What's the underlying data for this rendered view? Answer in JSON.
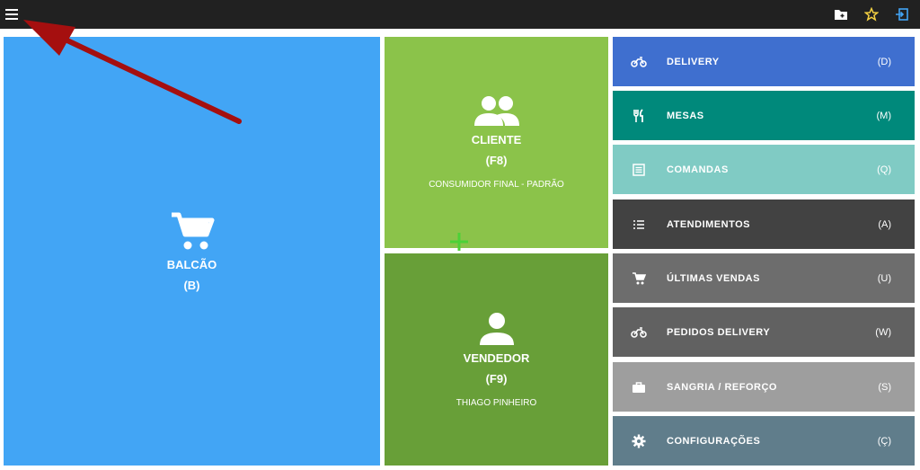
{
  "topbar": {
    "icons": [
      "menu-icon",
      "new-folder-icon",
      "star-outline-icon",
      "logout-icon"
    ],
    "accent": "#42a5f5"
  },
  "balcao": {
    "title": "BALCÃO",
    "key": "(B)",
    "color": "#42a5f5",
    "icon": "shopping-cart-icon"
  },
  "cliente": {
    "title": "CLIENTE",
    "key": "(F8)",
    "sub": "CONSUMIDOR FINAL - PADRÃO",
    "color": "#8bc34a",
    "icon": "people-icon"
  },
  "vendedor": {
    "title": "VENDEDOR",
    "key": "(F9)",
    "sub": "THIAGO PINHEIRO",
    "color": "#689f38",
    "icon": "person-icon"
  },
  "menu": [
    {
      "label": "DELIVERY",
      "key": "(D)",
      "color": "#3f6fcf",
      "icon": "motorcycle-icon"
    },
    {
      "label": "MESAS",
      "key": "(M)",
      "color": "#00897b",
      "icon": "utensils-icon"
    },
    {
      "label": "COMANDAS",
      "key": "(Q)",
      "color": "#80cbc4",
      "icon": "list-box-icon"
    },
    {
      "label": "ATENDIMENTOS",
      "key": "(A)",
      "color": "#424242",
      "icon": "list-icon"
    },
    {
      "label": "ÚLTIMAS VENDAS",
      "key": "(U)",
      "color": "#6d6d6d",
      "icon": "cart-icon"
    },
    {
      "label": "PEDIDOS DELIVERY",
      "key": "(W)",
      "color": "#616161",
      "icon": "motorcycle-icon"
    },
    {
      "label": "SANGRIA / REFORÇO",
      "key": "(S)",
      "color": "#9e9e9e",
      "icon": "briefcase-icon"
    },
    {
      "label": "CONFIGURAÇÕES",
      "key": "(Ç)",
      "color": "#607d8b",
      "icon": "gear-icon"
    }
  ]
}
